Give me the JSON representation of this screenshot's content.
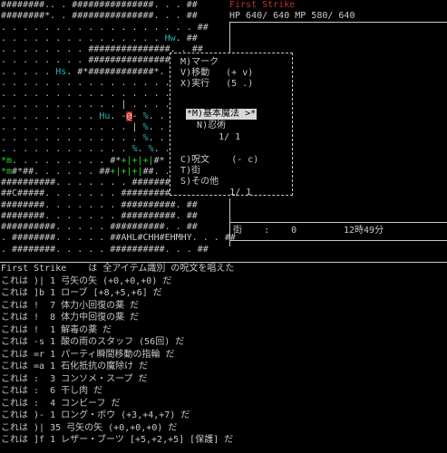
{
  "map_rows": [
    "########.. . ###############. . . ##",
    "########*. . ###############. . . ##",
    ". . . . . . . . . . . . . . . . . . ##",
    ". . . . . . . . . . . . . . . Hw. ##",
    ". . . . . . . . ###############. . ##",
    ". . . . . . . . ###############. . ##",
    ". . . . . Hs. #*############*. . ##",
    ". . . . . . . . . . . . . . . . . ##",
    ". . . . . . . . . . . . . . . . . ##",
    ". . . . . . . . . . . | . . . . ##",
    ". . . . . . . . . Hu. -@- %. . . ##",
    ". . . . . . . . . . . . | %. . . . ##",
    ". . . . . . . . . . . . . %. . . ##",
    ". . . . . . . . . . . . %. %. . . ##",
    "*m. . . . . . . . . #*+|+|+|#*",
    "*m#*##. . . . . . ##+|+|+|##. . ##",
    "##########. . . . . . . ##########. ##",
    "##C#####. . . . . . . ##########. ##",
    "########. . . . . . . ##########. ##",
    "########. . . . . . . ##########. ##",
    "##########. . . . . ##########. . ##",
    ". ########. . . . . ##AHL#CHH#EHMHY. . . ##",
    ". ########. . . . . ##########. . . ##"
  ],
  "status": {
    "name": "First Strike",
    "hpmp": "HP 640/ 640 MP 580/ 640",
    "place_label": "街    :    0",
    "time": "12時49分"
  },
  "menu": {
    "items": [
      {
        "label": "M)マーク",
        "hint": ""
      },
      {
        "label": "V)移動",
        "hint": "(+ v)"
      },
      {
        "label": "X)実行",
        "hint": "(5 .)"
      }
    ],
    "items2": [
      {
        "label": "C)呪文",
        "hint": "(- c)"
      },
      {
        "label": "T)街",
        "hint": ""
      },
      {
        "label": "S)その他",
        "hint": ""
      }
    ],
    "page": "1/ 1"
  },
  "submenu": {
    "selected": "*M)基本魔法 >*",
    "items": [
      "N)忍術"
    ],
    "page": "1/ 1"
  },
  "log": [
    "First Strike    は 全アイテム識別 の呪文を唱えた",
    "これは )| 1 弓矢の矢 (+0,+0,+0) だ",
    "これは ]b 1 ローブ [+8,+5,+6] だ",
    "これは !  7 体力小回復の薬 だ",
    "これは !  8 体力中回復の薬 だ",
    "これは !  1 解毒の薬 だ",
    "これは -s 1 酸の雨のスタッフ (56回) だ",
    "これは =r 1 パーティ瞬間移動の指輪 だ",
    "これは =a 1 石化抵抗の魔除け だ",
    "これは :  3 コンソメ・スープ だ",
    "これは :  6 干し肉 だ",
    "これは :  4 コンビーフ だ",
    "これは )- 1 ロング・ボウ (+3,+4,+7) だ",
    "これは )| 35 弓矢の矢 (+0,+0,+0) だ",
    "これは ]f 1 レザー・ブーツ [+5,+2,+5] [保護] だ"
  ]
}
